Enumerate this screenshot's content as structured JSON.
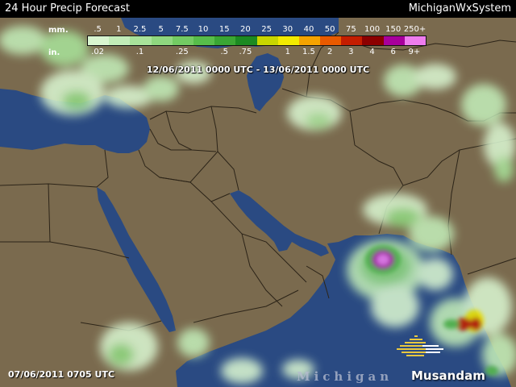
{
  "header": {
    "title": "24 Hour Precip Forecast",
    "brand": "MichiganWxSystem"
  },
  "legend": {
    "mm_unit": "mm.",
    "in_unit": "in.",
    "mm_labels": [
      ".5",
      "1",
      "2.5",
      "5",
      "7.5",
      "10",
      "15",
      "20",
      "25",
      "30",
      "40",
      "50",
      "75",
      "100",
      "150",
      "250+"
    ],
    "in_labels": [
      ".02",
      "",
      ".1",
      "",
      ".25",
      "",
      ".5",
      ".75",
      "",
      "1",
      "1.5",
      "2",
      "3",
      "4",
      "6",
      "9+"
    ],
    "colors": [
      "#d9f5d0",
      "#c2ecb8",
      "#a8e29a",
      "#8fd77f",
      "#73cb63",
      "#57bd4a",
      "#3aa634",
      "#1c8a22",
      "#c8d600",
      "#f2ea00",
      "#f5a300",
      "#e85a00",
      "#c41d00",
      "#8c0000",
      "#a8009c",
      "#ee7cee"
    ]
  },
  "map": {
    "valid_range": "12/06/2011 0000 UTC - 13/06/2011 0000 UTC",
    "init_time": "07/06/2011 0705 UTC",
    "watermark": "Michigan",
    "logo_text": "Musandam",
    "colors": {
      "land": "#7a6a4e",
      "water": "#2a4a82",
      "border": "#2c2418"
    }
  }
}
